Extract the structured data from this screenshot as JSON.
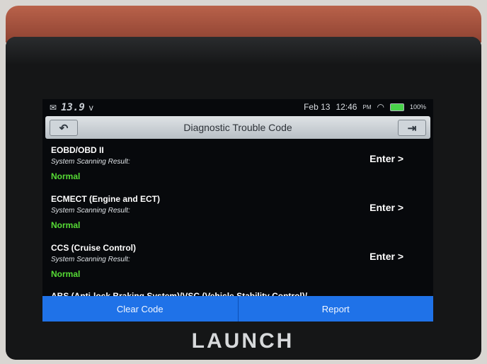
{
  "status_bar": {
    "voltage": "13.9",
    "voltage_unit": "v",
    "date": "Feb 13",
    "time": "12:46",
    "ampm": "PM",
    "battery": "100%",
    "icons": [
      "message-icon",
      "wifi-icon",
      "battery-icon"
    ],
    "battery_color": "#49d34a"
  },
  "header": {
    "title": "Diagnostic Trouble Code",
    "back_icon": "back-arrow-icon",
    "exit_icon": "exit-icon"
  },
  "systems": [
    {
      "name": "EOBD/OBD II",
      "label": "System Scanning Result:",
      "result": "Normal",
      "action": "Enter >"
    },
    {
      "name": "ECMECT (Engine and ECT)",
      "label": "System Scanning Result:",
      "result": "Normal",
      "action": "Enter >"
    },
    {
      "name": "CCS (Cruise Control)",
      "label": "System Scanning Result:",
      "result": "Normal",
      "action": "Enter >"
    },
    {
      "name": "ABS (Anti-lock Braking System)/VSC (Vehicle Stability Control)/"
    }
  ],
  "footer": {
    "clear": "Clear Code",
    "report": "Report"
  },
  "device": {
    "brand": "LAUNCH"
  },
  "colors": {
    "accent": "#1f72e8",
    "status_ok": "#56db35"
  }
}
